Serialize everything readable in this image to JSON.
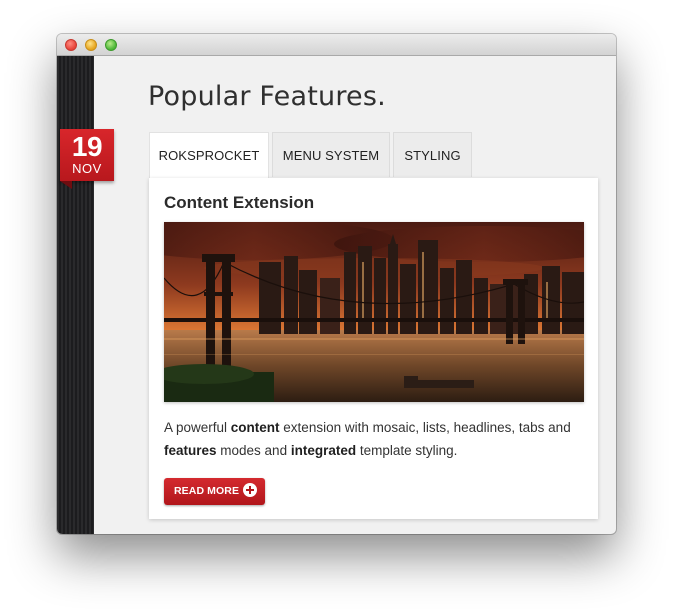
{
  "date_badge": {
    "day": "19",
    "month": "NOV"
  },
  "page": {
    "title": "Popular Features."
  },
  "tabs": [
    {
      "label": "ROKSPROCKET",
      "active": true
    },
    {
      "label": "MENU SYSTEM",
      "active": false
    },
    {
      "label": "STYLING",
      "active": false
    }
  ],
  "panel": {
    "heading": "Content Extension",
    "image_subject": "city skyline with suspension bridge at sunset",
    "text_parts": [
      {
        "t": "A powerful ",
        "bold": false
      },
      {
        "t": "content",
        "bold": true
      },
      {
        "t": " extension with mosaic, lists, headlines, tabs and ",
        "bold": false
      },
      {
        "t": "features",
        "bold": true
      },
      {
        "t": " modes and ",
        "bold": false
      },
      {
        "t": "integrated",
        "bold": true
      },
      {
        "t": " template styling.",
        "bold": false
      }
    ],
    "read_more_label": "READ MORE"
  },
  "colors": {
    "accent": "#c41e23",
    "window_bg": "#f1f1f1",
    "sidebar": "#222224"
  }
}
